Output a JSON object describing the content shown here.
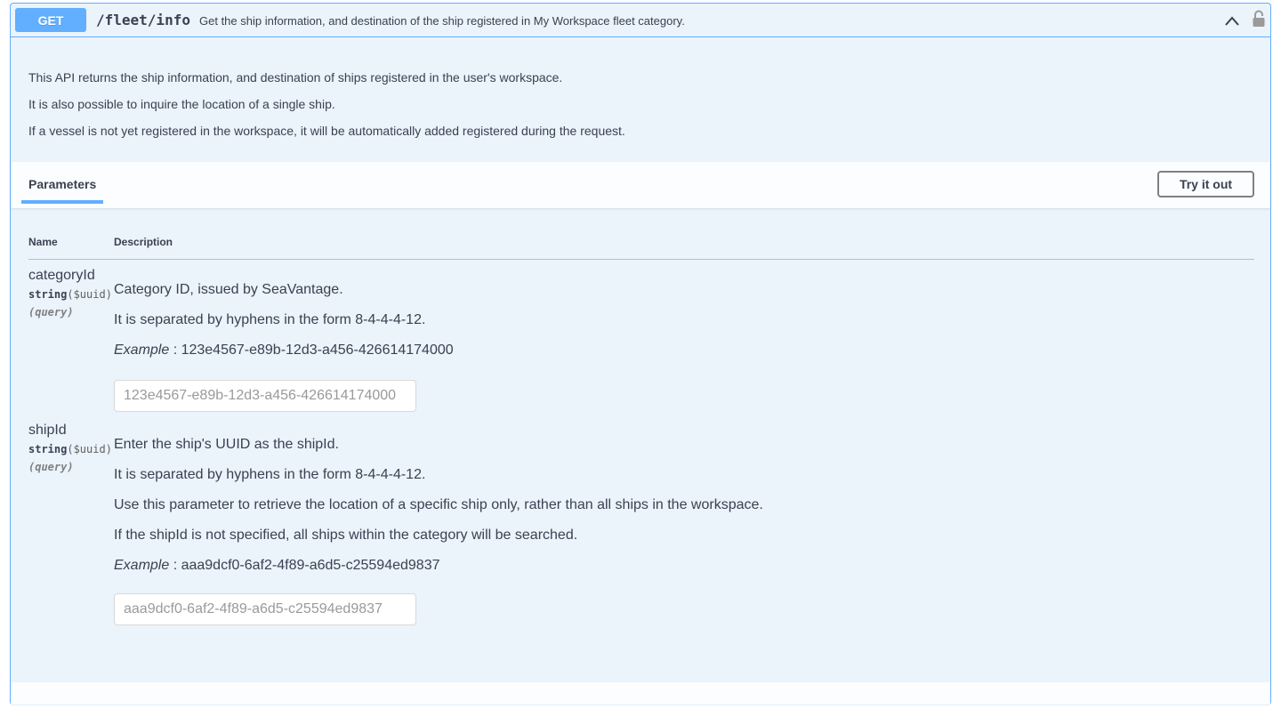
{
  "operation": {
    "method": "GET",
    "path": "/fleet/info",
    "summary": "Get the ship information, and destination of the ship registered in My Workspace fleet category.",
    "collapse_icon": "chevron-up-icon",
    "lock_icon": "lock-icon",
    "accent_color": "#61affe"
  },
  "description": {
    "line1": "This API returns the ship information, and destination of ships registered in the user's workspace.",
    "line2": "It is also possible to inquire the location of a single ship.",
    "line3": "If a vessel is not yet registered in the workspace, it will be automatically added registered during the request."
  },
  "parameters_section": {
    "tab_label": "Parameters",
    "try_button": "Try it out",
    "col_name": "Name",
    "col_description": "Description"
  },
  "params": [
    {
      "name": "categoryId",
      "type": "string",
      "format": "($uuid)",
      "in": "(query)",
      "desc1": "Category ID, issued by SeaVantage.",
      "desc2": "It is separated by hyphens in the form 8-4-4-4-12.",
      "example_label": "Example",
      "example_value": " : 123e4567-e89b-12d3-a456-426614174000",
      "placeholder": "123e4567-e89b-12d3-a456-426614174000"
    },
    {
      "name": "shipId",
      "type": "string",
      "format": "($uuid)",
      "in": "(query)",
      "desc1": "Enter the ship's UUID as the shipId.",
      "desc2": "It is separated by hyphens in the form 8-4-4-4-12.",
      "desc3": "Use this parameter to retrieve the location of a specific ship only, rather than all ships in the workspace.",
      "desc4": "If the shipId is not specified, all ships within the category will be searched.",
      "example_label": "Example",
      "example_value": " : aaa9dcf0-6af2-4f89-a6d5-c25594ed9837",
      "placeholder": "aaa9dcf0-6af2-4f89-a6d5-c25594ed9837"
    }
  ]
}
